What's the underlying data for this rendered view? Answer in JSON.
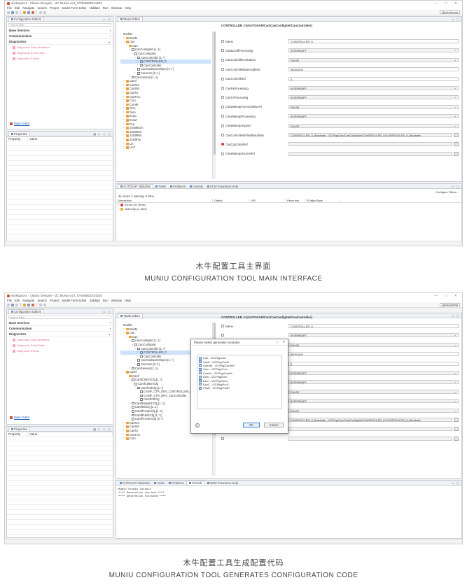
{
  "shot1": {
    "window_title": "workspace1 - Classic Designer - ZC MuNiu v4.4_STSMMDD101010",
    "window_controls": [
      "—",
      "□",
      "✕"
    ],
    "menu": [
      "File",
      "Edit",
      "Navigate",
      "Search",
      "Project",
      "Model Form Editor",
      "Validate",
      "Run",
      "Window",
      "Help"
    ],
    "quick_access": "Quick Access",
    "config_tab": "Configuration Editors",
    "filter_placeholder": "text to filter...",
    "categories": [
      "Base Services",
      "Communication",
      "Diagnostics"
    ],
    "diag_items": [
      "Diagnostic Data Identifiers",
      "Diagnostic Event Data",
      "Diagnostic Events"
    ],
    "basic_editor_link": "Basic Editor",
    "properties_tab": "Properties",
    "props_headers": [
      "Property",
      "Value"
    ],
    "editor_tab": "*Basic Editor",
    "tree": [
      {
        "label": "Models",
        "d": 0,
        "a": "",
        "icon": ""
      },
      {
        "label": "BswM",
        "d": 1,
        "a": "›",
        "icon": "mod"
      },
      {
        "label": "Can",
        "d": 1,
        "a": "⌄",
        "icon": "mod"
      },
      {
        "label": "Can",
        "d": 2,
        "a": "⌄",
        "icon": "mod"
      },
      {
        "label": "CanConfigSet [1..1]",
        "d": 3,
        "a": "⌄",
        "icon": "cont"
      },
      {
        "label": "CanConfigSet",
        "d": 4,
        "a": "⌄",
        "icon": "cont"
      },
      {
        "label": "CanController [1..*]",
        "d": 5,
        "a": "⌄",
        "icon": "cont"
      },
      {
        "label": "CONTROLLER_0",
        "d": 6,
        "a": "›",
        "icon": "cont2",
        "sel": true
      },
      {
        "label": "CanController",
        "d": 6,
        "a": "›",
        "icon": "cont"
      },
      {
        "label": "CanHardwareObject [1..*]",
        "d": 5,
        "a": "›",
        "icon": "cont"
      },
      {
        "label": "CanIcom [0..1]",
        "d": 5,
        "a": "›",
        "icon": "cont"
      },
      {
        "label": "CanGeneral [1..1]",
        "d": 3,
        "a": "›",
        "icon": "cont"
      },
      {
        "label": "CanIf",
        "d": 1,
        "a": "›",
        "icon": "mod"
      },
      {
        "label": "CanNm",
        "d": 1,
        "a": "›",
        "icon": "mod"
      },
      {
        "label": "CanSM",
        "d": 1,
        "a": "›",
        "icon": "mod"
      },
      {
        "label": "CanTp",
        "d": 1,
        "a": "›",
        "icon": "mod"
      },
      {
        "label": "CanTrcv",
        "d": 1,
        "a": "›",
        "icon": "mod"
      },
      {
        "label": "Com",
        "d": 1,
        "a": "›",
        "icon": "mod"
      },
      {
        "label": "ComM",
        "d": 1,
        "a": "›",
        "icon": "mod"
      },
      {
        "label": "Dcm",
        "d": 1,
        "a": "›",
        "icon": "mod"
      },
      {
        "label": "Dem",
        "d": 1,
        "a": "›",
        "icon": "mod"
      },
      {
        "label": "EcuC",
        "d": 1,
        "a": "›",
        "icon": "mod"
      },
      {
        "label": "EcuM",
        "d": 1,
        "a": "›",
        "icon": "mod"
      },
      {
        "label": "Fee",
        "d": 1,
        "a": "›",
        "icon": "mod"
      },
      {
        "label": "J1939Dcm",
        "d": 1,
        "a": "›",
        "icon": "mod"
      },
      {
        "label": "J1939Nm",
        "d": 1,
        "a": "›",
        "icon": "mod"
      },
      {
        "label": "J1939Rm",
        "d": 1,
        "a": "›",
        "icon": "mod"
      },
      {
        "label": "J1939Tp",
        "d": 1,
        "a": "›",
        "icon": "mod"
      },
      {
        "label": "Lin",
        "d": 1,
        "a": "›",
        "icon": "mod"
      },
      {
        "label": "LinIf",
        "d": 1,
        "a": "›",
        "icon": "mod"
      }
    ],
    "form_title": "CONTROLLER_0 [/AUTOSAR/Can/CanConfigSet/CanController]",
    "form_rows": [
      {
        "label": "Name",
        "value": "CONTROLLER_0",
        "kind": "text"
      },
      {
        "label": "CanBusoffProcessing",
        "value": "INTERRUPT",
        "kind": "dd"
      },
      {
        "label": "CanControllerActivation",
        "value": "FALSE",
        "kind": "dd"
      },
      {
        "label": "CanControllerBaseAddress",
        "value": "80001000",
        "kind": "text"
      },
      {
        "label": "CanControllerId",
        "value": "0",
        "kind": "text"
      },
      {
        "label": "CanRxProcessing",
        "value": "INTERRUPT",
        "kind": "dd"
      },
      {
        "label": "CanTxProcessing",
        "value": "INTERRUPT",
        "kind": "dd"
      },
      {
        "label": "CanWakeupFunctionalityAPI",
        "value": "FALSE",
        "kind": "dd"
      },
      {
        "label": "CanWakeupProcessing",
        "value": "INTERRUPT",
        "kind": "dd"
      },
      {
        "label": "CanWakeupSupport",
        "value": "FALSE",
        "kind": "dd"
      },
      {
        "label": "CanControllerDefaultBaudrate",
        "value": "CONTROLLER_0_Baudrate - /ZCPkg/Can/CanConfigSet/CONTROLLER_0/CONTROLLER_0_Baudrate",
        "kind": "ref"
      },
      {
        "label": "CanCpuClockRef",
        "value": "",
        "kind": "ref",
        "err": true
      },
      {
        "label": "CanWakeupSourceRef",
        "value": "",
        "kind": "ref"
      }
    ],
    "bottom_tabs": [
      "AUTOSAR Validation",
      "Tasks",
      "Problems",
      "Console",
      "ECM Parameter Help"
    ],
    "configure_filters": "Configure Filters...",
    "validation_summary": "41 errors, 1 warning, 0 infos",
    "validation_headers": [
      "Description",
      "Object",
      "URI",
      "Resource",
      "EObjectType"
    ],
    "validation_items": [
      "Errors (41 items)",
      "Warnings (1 item)"
    ]
  },
  "caption1": {
    "cn": "木牛配置工具主界面",
    "en": "MUNIU CONFIGURATION TOOL MAIN INTERFACE"
  },
  "shot2": {
    "tree": [
      {
        "label": "Models",
        "d": 0,
        "a": "",
        "icon": ""
      },
      {
        "label": "BswM",
        "d": 1,
        "a": "›",
        "icon": "mod"
      },
      {
        "label": "Can",
        "d": 1,
        "a": "⌄",
        "icon": "mod"
      },
      {
        "label": "Can",
        "d": 2,
        "a": "⌄",
        "icon": "mod"
      },
      {
        "label": "CanConfigSet [1..1]",
        "d": 3,
        "a": "⌄",
        "icon": "cont"
      },
      {
        "label": "CanConfigSet",
        "d": 4,
        "a": "⌄",
        "icon": "cont"
      },
      {
        "label": "CanController [1..*]",
        "d": 5,
        "a": "⌄",
        "icon": "cont"
      },
      {
        "label": "CONTROLLER_0",
        "d": 6,
        "a": "›",
        "icon": "cont2",
        "sel": true
      },
      {
        "label": "CanController",
        "d": 6,
        "a": "›",
        "icon": "cont"
      },
      {
        "label": "CanHardwareObject [1..*]",
        "d": 5,
        "a": "›",
        "icon": "cont"
      },
      {
        "label": "CanIcom [0..1]",
        "d": 5,
        "a": "›",
        "icon": "cont"
      },
      {
        "label": "CanGeneral [1..1]",
        "d": 3,
        "a": "›",
        "icon": "cont"
      },
      {
        "label": "CanIf",
        "d": 1,
        "a": "⌄",
        "icon": "mod"
      },
      {
        "label": "CanIf",
        "d": 2,
        "a": "⌄",
        "icon": "mod"
      },
      {
        "label": "CanIfCtrlDrvCfg [1..*]",
        "d": 3,
        "a": "⌄",
        "icon": "cont"
      },
      {
        "label": "CanIfCtrlDrvCfg",
        "d": 4,
        "a": "⌄",
        "icon": "cont"
      },
      {
        "label": "CanIfCtrlCfg [1..*]",
        "d": 5,
        "a": "⌄",
        "icon": "cont"
      },
      {
        "label": "CANIF_CTR_DRV_CONTROLLER_0",
        "d": 6,
        "a": "",
        "icon": "cont"
      },
      {
        "label": "CANIF_CTR_DRV_CanController",
        "d": 6,
        "a": "",
        "icon": "cont"
      },
      {
        "label": "CanIfCtrlCfg",
        "d": 6,
        "a": "",
        "icon": "cont"
      },
      {
        "label": "CanIfDispatchCfg [1..1]",
        "d": 3,
        "a": "›",
        "icon": "cont"
      },
      {
        "label": "CanIfInitCfg [1..1]",
        "d": 3,
        "a": "›",
        "icon": "cont"
      },
      {
        "label": "CanIfPrivateCfg [1..1]",
        "d": 3,
        "a": "›",
        "icon": "cont"
      },
      {
        "label": "CanIfPublicCfg [1..1]",
        "d": 3,
        "a": "›",
        "icon": "cont"
      },
      {
        "label": "CanIfTrcvDrvCfg [0..*]",
        "d": 3,
        "a": "›",
        "icon": "cont"
      },
      {
        "label": "CanNm",
        "d": 1,
        "a": "›",
        "icon": "mod"
      },
      {
        "label": "CanSM",
        "d": 1,
        "a": "›",
        "icon": "mod"
      },
      {
        "label": "CanTp",
        "d": 1,
        "a": "›",
        "icon": "mod"
      },
      {
        "label": "CanTrcv",
        "d": 1,
        "a": "›",
        "icon": "mod"
      },
      {
        "label": "Com",
        "d": 1,
        "a": "›",
        "icon": "mod"
      }
    ],
    "form_values": [
      {
        "value": "CONTROLLER_0",
        "kind": "text"
      },
      {
        "value": "INTERRUPT",
        "kind": "dd"
      },
      {
        "value": "FALSE",
        "kind": "dd"
      },
      {
        "value": "80001000",
        "kind": "text"
      },
      {
        "value": "0",
        "kind": "text"
      },
      {
        "value": "INTERRUPT",
        "kind": "dd"
      },
      {
        "value": "INTERRUPT",
        "kind": "dd"
      },
      {
        "value": "FALSE",
        "kind": "dd"
      },
      {
        "value": "INTERRUPT",
        "kind": "dd"
      },
      {
        "value": "FALSE",
        "kind": "dd"
      },
      {
        "value": "CONTROLLER_0_Baudrate - /ZCPkg/Can/CanConfigSet/CONTROLLER_0/CONTROLLER_0_Baudrate",
        "kind": "ref"
      },
      {
        "value": "",
        "kind": "ref"
      },
      {
        "value": "",
        "kind": "ref"
      }
    ],
    "dialog": {
      "title": "Please Select generation modules.",
      "items": [
        "Can - /ZCPkg/Can",
        "CanIf - /ZCPkg/CanIf",
        "CanSM - /ZCPkg/CanSM",
        "Com - /ZCPkg/Com",
        "ComM - /ZCPkg/ComM",
        "Dcm - /ZCPkg/Dcm",
        "Dem - /ZCPkg/Dem",
        "EcuC - /ZCPkg/EcuC",
        "PduR - /ZCPkg/PduR"
      ],
      "ok": "OK",
      "cancel": "Cancel",
      "help": "?"
    },
    "console_title": "MuNiu Studio Console",
    "console_lines": [
      "**** Generation started  ****",
      "**** Generation finished ****"
    ]
  },
  "caption2": {
    "cn": "木牛配置工具生成配置代码",
    "en": "MUNIU CONFIGURATION TOOL GENERATES CONFIGURATION CODE"
  },
  "colors": {
    "accent": "#3c7fd0",
    "module_icon": "#e8a23d",
    "error": "#d23b3b",
    "disabled_link": "#e46b8a"
  }
}
